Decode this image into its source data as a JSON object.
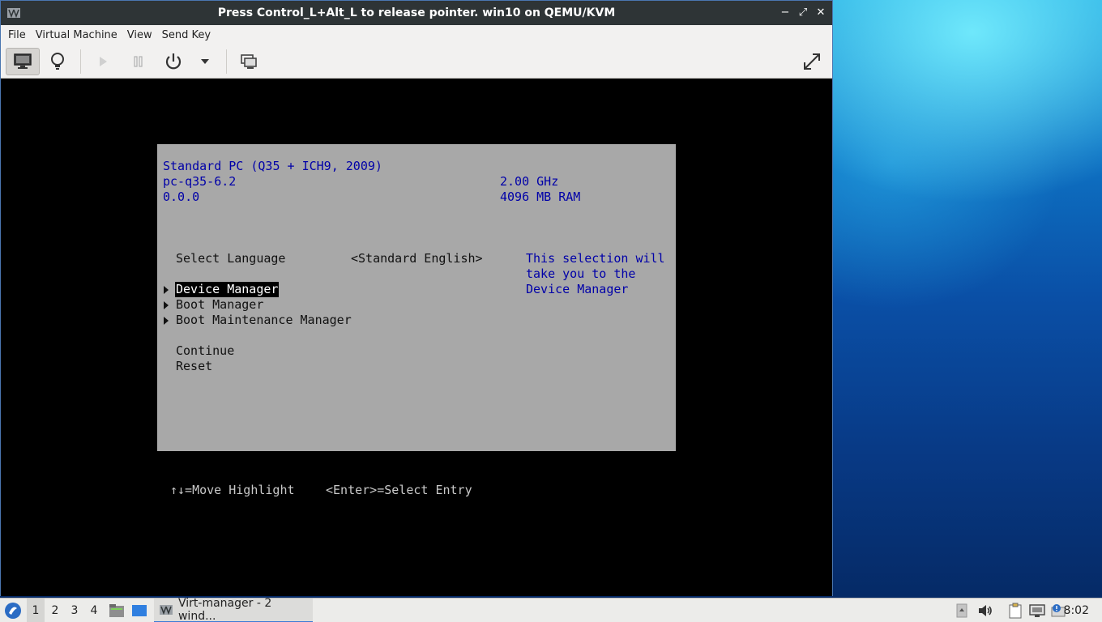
{
  "window": {
    "title": "Press Control_L+Alt_L to release pointer. win10 on QEMU/KVM",
    "buttons": {
      "minimize": "−",
      "maximize": "⤢",
      "close": "✕"
    }
  },
  "menu": [
    "File",
    "Virtual Machine",
    "View",
    "Send Key"
  ],
  "toolbar": {
    "items": [
      "console-icon",
      "lightbulb-icon",
      "run-icon",
      "pause-icon",
      "power-icon",
      "dropdown-icon",
      "snapshot-icon",
      "fullscreen-icon"
    ]
  },
  "bios": {
    "machine": "Standard PC (Q35 + ICH9, 2009)",
    "model": "pc-q35-6.2",
    "version": "0.0.0",
    "cpu": "2.00 GHz",
    "ram": "4096 MB RAM",
    "language_label": "Select Language",
    "language_value": "<Standard English>",
    "help_lines": [
      "This selection will",
      "take you to the",
      "Device Manager"
    ],
    "menu": [
      "Device Manager",
      "Boot Manager",
      "Boot Maintenance Manager"
    ],
    "actions": [
      "Continue",
      "Reset"
    ],
    "footer_move": "↑↓=Move Highlight",
    "footer_select": "<Enter>=Select Entry"
  },
  "taskbar": {
    "workspaces": [
      "1",
      "2",
      "3",
      "4"
    ],
    "active_workspace": "1",
    "task_label": "Virt-manager - 2 wind...",
    "clock": "8:02"
  },
  "colors": {
    "bios_bg": "#a8a8a8",
    "bios_blue": "#0000a8",
    "titlebar": "#2e3436"
  }
}
